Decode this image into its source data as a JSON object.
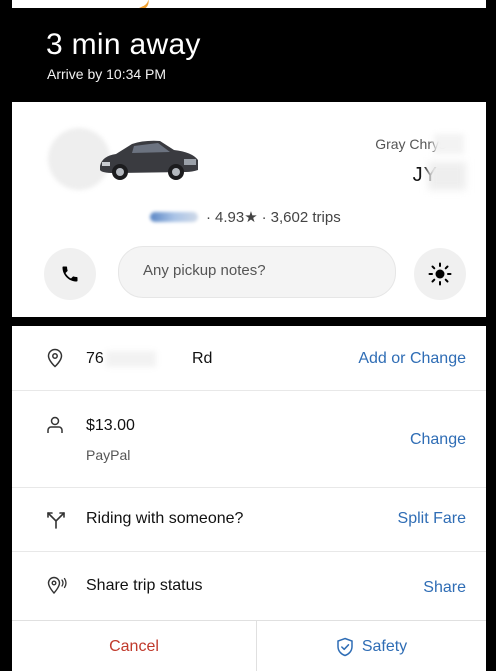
{
  "header": {
    "eta": "3 min away",
    "arrive_by": "Arrive by 10:34 PM"
  },
  "driver": {
    "car_model": "Gray Chrys",
    "plate": "JY",
    "rating": "4.93★",
    "trips": "3,602 trips",
    "separator": "·"
  },
  "notes": {
    "placeholder": "Any pickup notes?"
  },
  "trip": {
    "address_prefix": "76",
    "address_suffix": "Rd",
    "address_action": "Add or Change",
    "fare": "$13.00",
    "payment_method": "PayPal",
    "fare_action": "Change",
    "riding_label": "Riding with someone?",
    "riding_action": "Split Fare",
    "share_label": "Share trip status",
    "share_action": "Share"
  },
  "footer": {
    "cancel": "Cancel",
    "safety": "Safety"
  },
  "colors": {
    "accent": "#2f6db5",
    "danger": "#c0392b",
    "header_bg": "#000000"
  }
}
